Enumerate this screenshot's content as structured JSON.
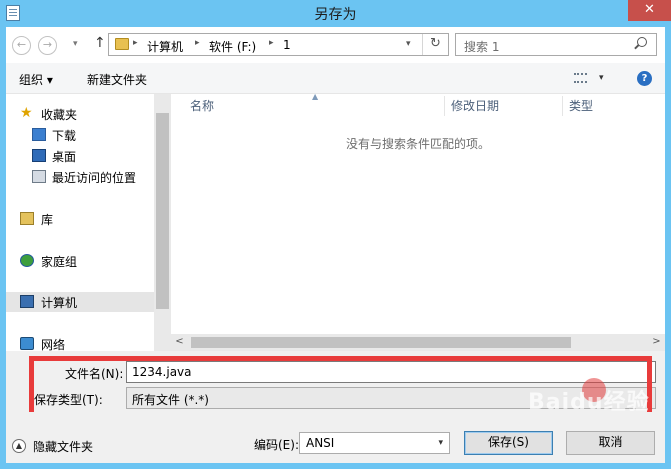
{
  "window": {
    "title": "另存为",
    "close_label": "✕"
  },
  "nav": {
    "back": "←",
    "forward": "→",
    "dropdown": "▾",
    "up": "↑",
    "breadcrumb": [
      "计算机",
      "软件 (F:)",
      "1"
    ],
    "separator": "▸",
    "address_dropdown": "▾",
    "refresh": "↻",
    "search_placeholder": "搜索 1"
  },
  "toolbar": {
    "organize_label": "组织 ▾",
    "new_folder_label": "新建文件夹",
    "view_dropdown": "▾",
    "help": "?"
  },
  "sidebar": {
    "items": [
      {
        "label": "收藏夹",
        "icon": "star-icon"
      },
      {
        "label": "下载",
        "icon": "downloads-folder-icon"
      },
      {
        "label": "桌面",
        "icon": "desktop-icon"
      },
      {
        "label": "最近访问的位置",
        "icon": "recent-places-icon"
      },
      {
        "label": "库",
        "icon": "library-icon"
      },
      {
        "label": "家庭组",
        "icon": "homegroup-icon"
      },
      {
        "label": "计算机",
        "icon": "computer-icon"
      },
      {
        "label": "网络",
        "icon": "network-icon"
      }
    ]
  },
  "filelist": {
    "columns": [
      "名称",
      "修改日期",
      "类型"
    ],
    "sort_indicator": "▲",
    "empty_message": "没有与搜索条件匹配的项。"
  },
  "scroll": {
    "left": "<",
    "right": ">"
  },
  "form": {
    "filename_label": "文件名(N):",
    "filename_value": "1234.java",
    "type_label": "保存类型(T):",
    "type_value": "所有文件  (*.*)"
  },
  "bottom": {
    "hide_icon": "▲",
    "hide_folders_label": "隐藏文件夹",
    "encoding_label": "编码(E):",
    "encoding_value": "ANSI",
    "encoding_dropdown": "▾",
    "save_label": "保存(S)",
    "cancel_label": "取消"
  },
  "watermark": "Baidu经验",
  "colors": {
    "title_bar": "#6bc4f2",
    "highlight": "#e83b3b",
    "close": "#c7504b"
  }
}
